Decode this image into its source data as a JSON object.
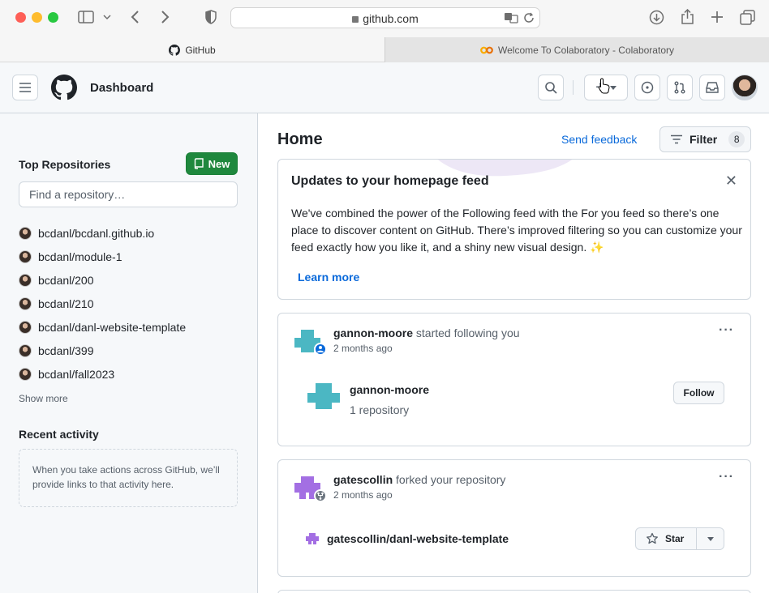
{
  "browser": {
    "url": "github.com",
    "tabs": [
      {
        "label": "GitHub"
      },
      {
        "label": "Welcome To Colaboratory - Colaboratory"
      }
    ]
  },
  "header": {
    "title": "Dashboard",
    "plus_label": "+"
  },
  "sidebar": {
    "top_repos_heading": "Top Repositories",
    "new_button": "New",
    "find_placeholder": "Find a repository…",
    "repos": [
      "bcdanl/bcdanl.github.io",
      "bcdanl/module-1",
      "bcdanl/200",
      "bcdanl/210",
      "bcdanl/danl-website-template",
      "bcdanl/399",
      "bcdanl/fall2023"
    ],
    "show_more": "Show more",
    "recent_heading": "Recent activity",
    "recent_text": "When you take actions across GitHub, we’ll provide links to that activity here."
  },
  "main": {
    "title": "Home",
    "send_feedback": "Send feedback",
    "filter_label": "Filter",
    "filter_count": "8",
    "update_card": {
      "title": "Updates to your homepage feed",
      "body": "We've combined the power of the Following feed with the For you feed so there’s one place to discover content on GitHub. There’s improved filtering so you can customize your feed exactly how you like it, and a shiny new visual design. ✨",
      "learn_more": "Learn more"
    },
    "events": [
      {
        "actor": "gannon-moore",
        "action": " started following you",
        "time": "2 months ago",
        "target_name": "gannon-moore",
        "target_sub": "1 repository",
        "button": "Follow",
        "color": "#4bb7c3"
      },
      {
        "actor": "gatescollin",
        "action": " forked your repository",
        "time": "2 months ago",
        "repo": "gatescollin/danl-website-template",
        "star_label": "Star",
        "color": "#a36fe3"
      }
    ]
  }
}
